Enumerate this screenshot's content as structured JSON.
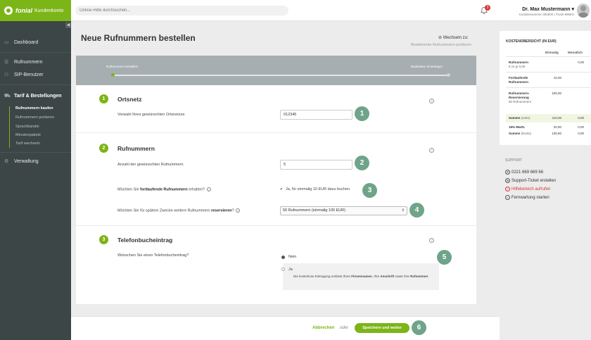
{
  "brand": {
    "name": "fonial",
    "sub": "Kundenkonto"
  },
  "search": {
    "placeholder": "Online-Hilfe durchsuchen..."
  },
  "notifications": {
    "count": "3"
  },
  "user": {
    "name": "Dr. Max Mustermann ▾",
    "sub": "Kundennummer 000000 | Trunk 99MIO"
  },
  "sidebar": {
    "items": [
      {
        "label": "Dashboard",
        "icon": "dashboard-icon"
      },
      {
        "label": "Rufnummern",
        "icon": "phone-book-icon"
      },
      {
        "label": "SIP-Benutzer",
        "icon": "users-icon"
      },
      {
        "label": "Tarif & Bestellungen",
        "icon": "cart-icon"
      },
      {
        "label": "Verwaltung",
        "icon": "gear-icon"
      }
    ],
    "subitems": [
      "Rufnummern kaufen",
      "Rufnummern portieren",
      "Sprachkanäle",
      "Minutenpakete",
      "Tarif wechseln"
    ]
  },
  "page": {
    "title": "Neue Rufnummern bestellen",
    "switch_head": "Wechseln zu:",
    "switch_link": "Bestehende Rufnummern portieren"
  },
  "progress": {
    "left": "Rufnummern bestellen",
    "right": "Bankdaten hinterlegen"
  },
  "sections": {
    "s1": {
      "num": "1",
      "title": "Ortsnetz",
      "label": "Vorwahl Ihres gewünschten Ortsnetzes",
      "value": "012345",
      "badge": "1"
    },
    "s2": {
      "num": "2",
      "title": "Rufnummern",
      "count_label": "Anzahl der gewünschten Rufnummern",
      "count_value": "5",
      "badge2": "2",
      "q1_pre": "Möchten Sie ",
      "q1_bold": "fortlaufende Rufnummern",
      "q1_post": " erhalten?",
      "q1_answer": "Ja, für einmalig 10 EUR dazu buchen",
      "badge3": "3",
      "q2_pre": "Möchten Sie für spätere Zwecke weitere Rufnummern ",
      "q2_bold": "reservieren",
      "q2_post": "?",
      "q2_value": "50 Rufnummern (einmalig 100 EUR)",
      "badge4": "4"
    },
    "s3": {
      "num": "3",
      "title": "Telefonbucheintrag",
      "label": "Wünschen Sie einen Telefonbucheintrag?",
      "opt_no": "Nein",
      "opt_yes": "Ja",
      "desc_pre": "Die kostenlose Eintragung umfasst Ihren ",
      "desc_b1": "Firmennamen",
      "desc_mid": ", Ihre ",
      "desc_b2": "Anschrift",
      "desc_post": " sowie Ihre ",
      "desc_b3": "Rufnummer",
      "desc_end": ".",
      "badge5": "5"
    }
  },
  "footer": {
    "cancel": "Abbrechen",
    "or": "oder",
    "save": "Speichern und weiter",
    "badge6": "6"
  },
  "costs": {
    "title": "KOSTENÜBERSICHT (IN EUR)",
    "col_once": "Einmalig",
    "col_monthly": "Monatlich",
    "rows": [
      {
        "label": "Rufnummern",
        "sub": "5 zu je 0,00",
        "once": "",
        "monthly": "0,00"
      },
      {
        "label": "Fortlaufende Rufnummern",
        "sub": "",
        "once": "10,00",
        "monthly": ""
      },
      {
        "label": "Rufnummern-Reservierung",
        "sub": "50 Rufnummern",
        "once": "100,00",
        "monthly": ""
      }
    ],
    "sum_net": {
      "label": "Summe",
      "sub": "(netto)",
      "once": "110,00",
      "monthly": "0,00"
    },
    "vat": {
      "label": "19% MwSt.",
      "once": "20,90",
      "monthly": "0,00"
    },
    "sum_gross": {
      "label": "Summe",
      "sub": "(brutto)",
      "once": "130,90",
      "monthly": "0,00"
    }
  },
  "support": {
    "title": "SUPPORT",
    "items": [
      {
        "label": "0221 669 669 66",
        "icon": "phone-icon"
      },
      {
        "label": "Support-Ticket erstellen",
        "icon": "ticket-icon"
      },
      {
        "label": "Hilfebereich aufrufen",
        "icon": "help-icon"
      },
      {
        "label": "Fernwartung starten",
        "icon": "remote-icon"
      }
    ]
  }
}
